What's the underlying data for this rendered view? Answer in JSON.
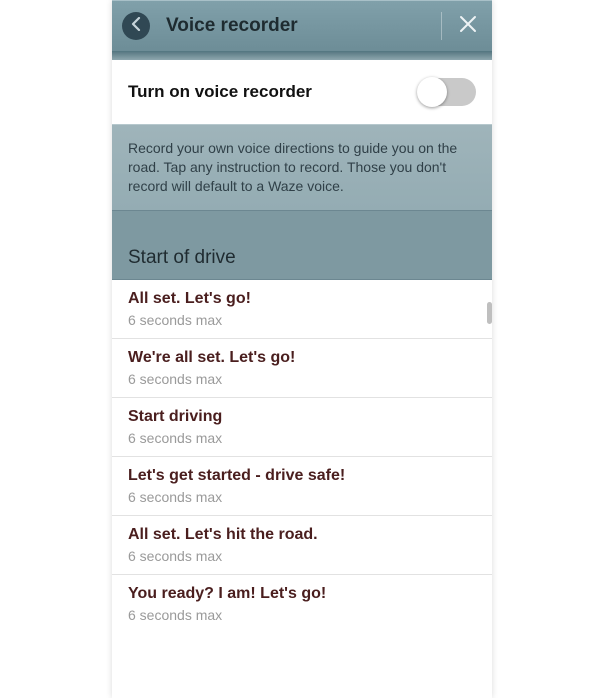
{
  "header": {
    "title": "Voice recorder"
  },
  "toggle": {
    "label": "Turn on voice recorder",
    "on": false
  },
  "info": "Record your own voice directions to guide you on the road. Tap any instruction to record. Those you don't record will default to a Waze voice.",
  "section": {
    "title": "Start of drive"
  },
  "items": [
    {
      "phrase": "All set. Let's go!",
      "max": "6 seconds max"
    },
    {
      "phrase": "We're all set. Let's go!",
      "max": "6 seconds max"
    },
    {
      "phrase": "Start driving",
      "max": "6 seconds max"
    },
    {
      "phrase": "Let's get started - drive safe!",
      "max": "6 seconds max"
    },
    {
      "phrase": "All set. Let's hit the road.",
      "max": "6 seconds max"
    },
    {
      "phrase": "You ready? I am! Let's go!",
      "max": "6 seconds max"
    }
  ]
}
